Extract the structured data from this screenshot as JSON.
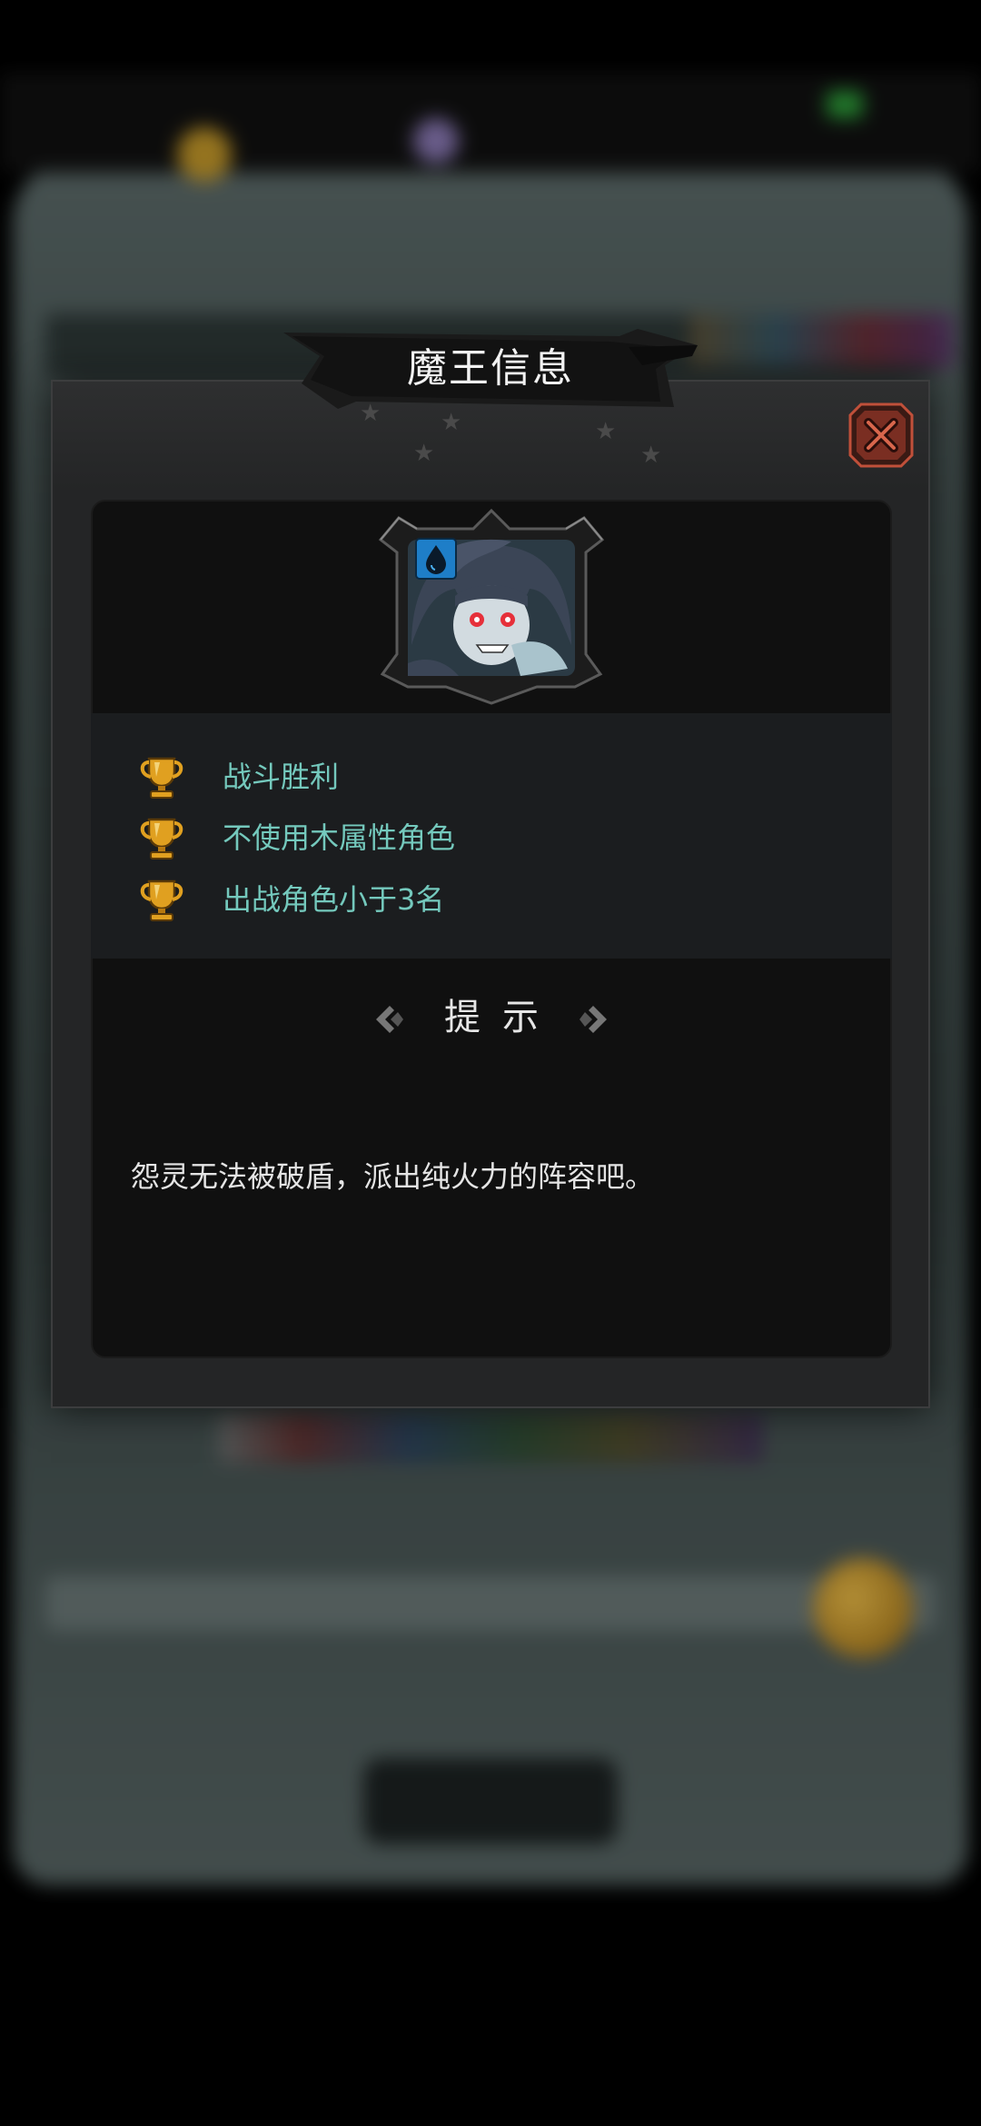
{
  "modal": {
    "title": "魔王信息",
    "close_icon": "close-icon"
  },
  "portrait": {
    "element_badge": "water-drop-icon"
  },
  "conditions": [
    {
      "icon": "trophy-icon",
      "label": "战斗胜利"
    },
    {
      "icon": "trophy-icon",
      "label": "不使用木属性角色"
    },
    {
      "icon": "trophy-icon",
      "label": "出战角色小于3名"
    }
  ],
  "hint": {
    "title": "提示",
    "text": "怨灵无法被破盾，派出纯火力的阵容吧。"
  },
  "colors": {
    "condition_text": "#74c9bd",
    "close_button": "#8a3a2a",
    "trophy": "#e0a020"
  }
}
